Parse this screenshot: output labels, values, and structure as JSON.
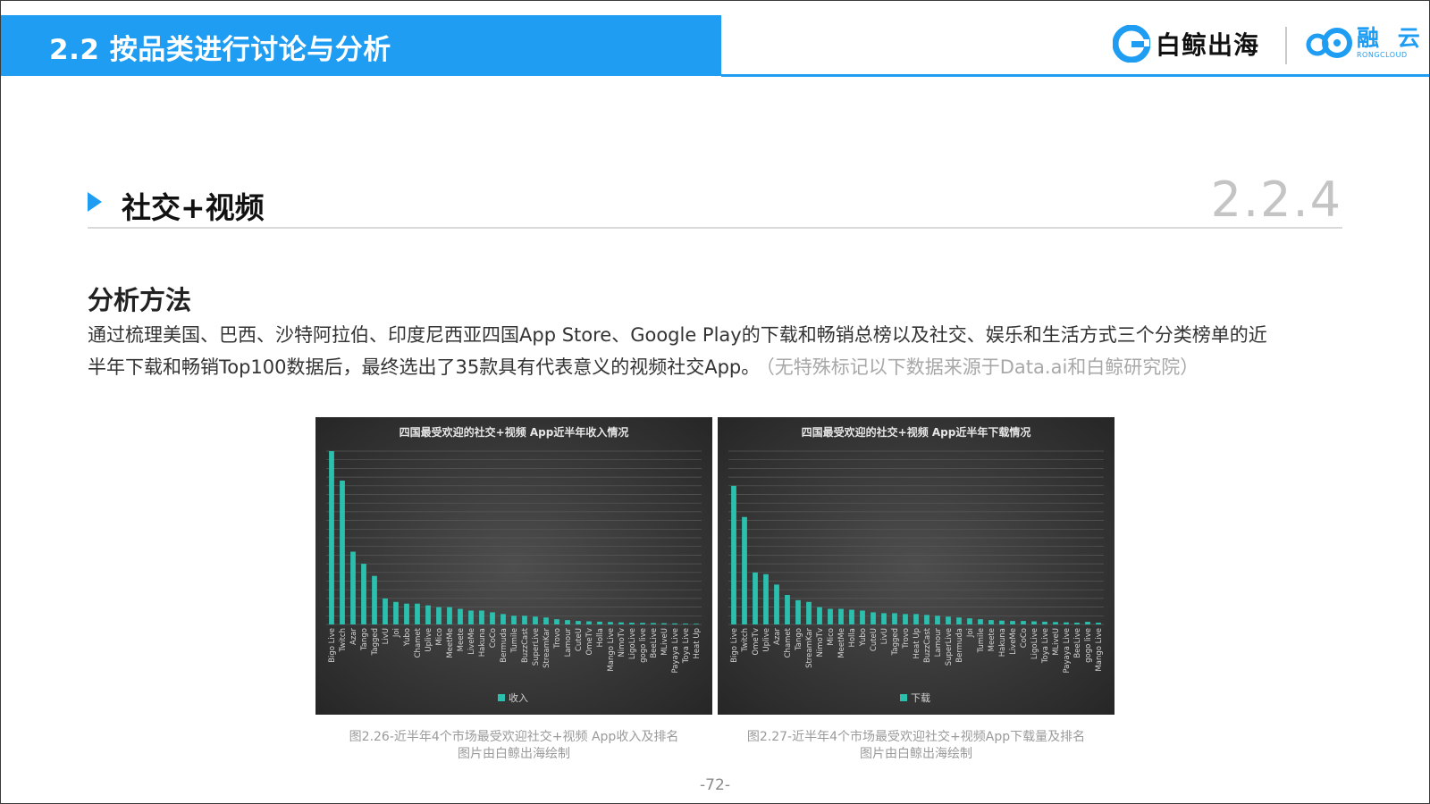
{
  "header": {
    "title": "2.2 按品类进行讨论与分析",
    "logo_left": "白鲸出海",
    "logo_right_cn": "融 云",
    "logo_right_en": "RONGCLOUD"
  },
  "section": {
    "title": "社交+视频",
    "number": "2.2.4"
  },
  "method": {
    "title": "分析方法",
    "line1": "通过梳理美国、巴西、沙特阿拉伯、印度尼西亚四国App  Store、Google  Play的下载和畅销总榜以及社交、娱乐和生活方式三个分类榜单的近",
    "line2": "半年下载和畅销Top100数据后，最终选出了35款具有代表意义的视频社交App。",
    "note": "（无特殊标记以下数据来源于Data.ai和白鲸研究院）"
  },
  "chart_data": [
    {
      "type": "bar",
      "title": "四国最受欢迎的社交+视频 App近半年收入情况",
      "legend": "收入",
      "legend_position": "bottom",
      "grid": true,
      "ylim": [
        0,
        100
      ],
      "categories": [
        "Bigo Live",
        "Twitch",
        "Azar",
        "Tango",
        "Tagged",
        "LivU",
        "Joi",
        "Yubo",
        "Chamet",
        "Uplive",
        "Mico",
        "MeetMe",
        "Meete",
        "LiveMe",
        "Hakuna",
        "CoCo",
        "Bermuda",
        "Tumile",
        "BuzzCast",
        "SuperLive",
        "StreamKar",
        "Trovo",
        "Lamour",
        "CuteU",
        "OmeTv",
        "Holla",
        "Mango Live",
        "NimoTv",
        "LigoLive",
        "gogo live",
        "BeeLive",
        "MLiveU",
        "Payaya Live",
        "Toya Live",
        "Heat Up"
      ],
      "series": [
        {
          "name": "收入",
          "values": [
            100,
            83,
            42,
            35,
            28,
            15,
            13,
            12,
            12,
            11,
            10,
            10,
            9,
            8,
            8,
            7,
            6,
            5,
            5,
            4.5,
            4,
            3,
            2.5,
            2,
            1.8,
            1.6,
            1.4,
            1.2,
            1,
            0.9,
            0.8,
            0.7,
            0.6,
            0.5,
            0.4
          ]
        }
      ]
    },
    {
      "type": "bar",
      "title": "四国最受欢迎的社交+视频 App近半年下载情况",
      "legend": "下载",
      "legend_position": "bottom",
      "grid": true,
      "ylim": [
        0,
        100
      ],
      "categories": [
        "Bigo Live",
        "Twitch",
        "OmeTv",
        "Uplive",
        "Azar",
        "Chamet",
        "Tango",
        "StreamKar",
        "NimoTv",
        "Mico",
        "MeetMe",
        "Holla",
        "Yubo",
        "CuteU",
        "LivU",
        "Tagged",
        "Trovo",
        "Heat Up",
        "BuzzCast",
        "Lamour",
        "SuperLive",
        "Bermuda",
        "Joi",
        "Tumile",
        "Meete",
        "Hakuna",
        "LiveMe",
        "CoCo",
        "LigoLive",
        "Toya Live",
        "MLiveU",
        "Payaya Live",
        "BeeLive",
        "gogo live",
        "Mango Live"
      ],
      "series": [
        {
          "name": "下载",
          "values": [
            80,
            62,
            30,
            29,
            23,
            17,
            14,
            13,
            10,
            9,
            9,
            8.5,
            8,
            7,
            6.5,
            6.5,
            6,
            6,
            5.5,
            5,
            4.5,
            4,
            3.5,
            3,
            2.5,
            2.2,
            2,
            2,
            1.8,
            1.6,
            1.4,
            1.2,
            1,
            1.5,
            1
          ]
        }
      ]
    }
  ],
  "captions": {
    "left": [
      "图2.26-近半年4个市场最受欢迎社交+视频 App收入及排名",
      "图片由白鲸出海绘制"
    ],
    "right": [
      "图2.27-近半年4个市场最受欢迎社交+视频App下载量及排名",
      "图片由白鲸出海绘制"
    ]
  },
  "page_number": "-72-",
  "colors": {
    "accent": "#1e9df2",
    "bar": "#2bbfae",
    "chart_bg": "#3a3a3a"
  }
}
